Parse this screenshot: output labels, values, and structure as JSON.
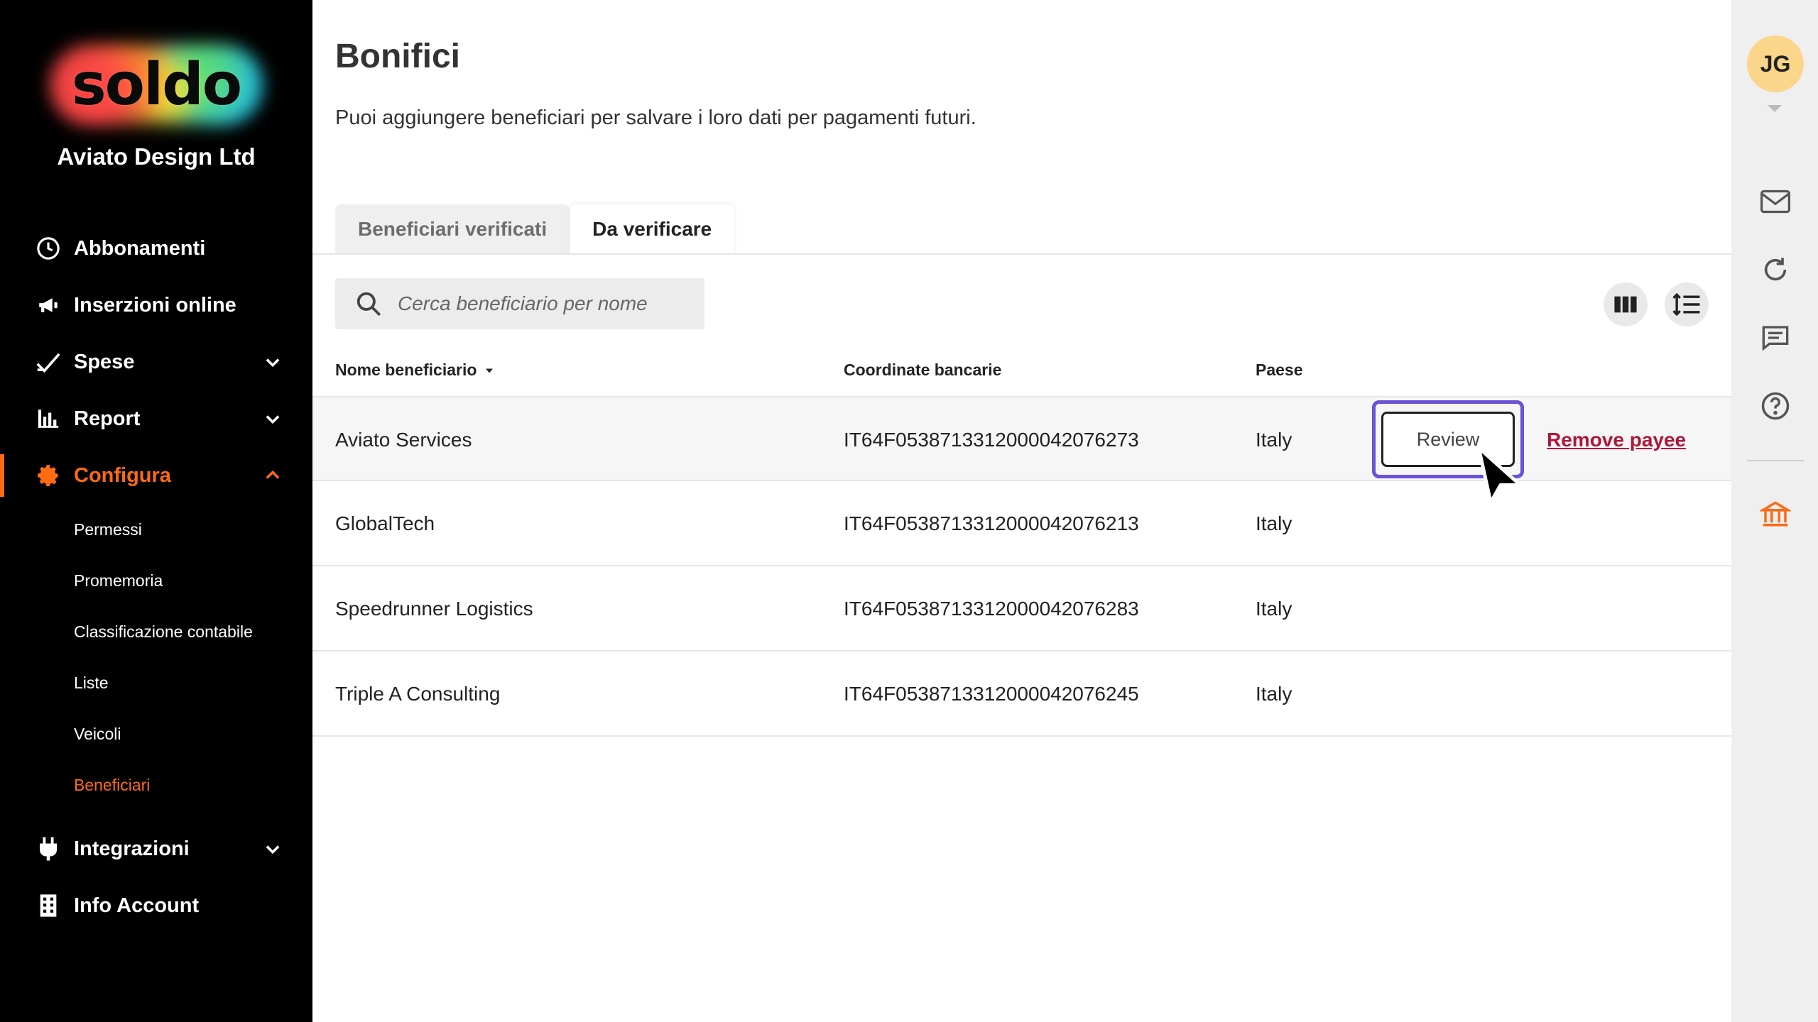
{
  "sidebar": {
    "logo_text": "soldo",
    "company": "Aviato Design Ltd",
    "items": [
      {
        "label": "Abbonamenti",
        "icon": "clock-icon"
      },
      {
        "label": "Inserzioni online",
        "icon": "megaphone-icon"
      },
      {
        "label": "Spese",
        "icon": "check-icon",
        "chevron": "down"
      },
      {
        "label": "Report",
        "icon": "bar-chart-icon",
        "chevron": "down"
      },
      {
        "label": "Configura",
        "icon": "gear-icon",
        "chevron": "up",
        "active": true
      },
      {
        "label": "Integrazioni",
        "icon": "plug-icon",
        "chevron": "down"
      },
      {
        "label": "Info Account",
        "icon": "building-icon"
      }
    ],
    "subitems": [
      "Permessi",
      "Promemoria",
      "Classificazione contabile",
      "Liste",
      "Veicoli",
      "Beneficiari"
    ],
    "active_subitem": "Beneficiari"
  },
  "header": {
    "title": "Bonifici",
    "description": "Puoi aggiungere beneficiari per salvare i loro dati per pagamenti futuri."
  },
  "tabs": [
    {
      "label": "Beneficiari verificati",
      "active": false
    },
    {
      "label": "Da verificare",
      "active": true
    }
  ],
  "search": {
    "placeholder": "Cerca beneficiario per nome"
  },
  "toolbar": {
    "columns_icon": "columns-icon",
    "density_icon": "line-spacing-icon"
  },
  "table": {
    "columns": [
      "Nome beneficiario",
      "Coordinate bancarie",
      "Paese"
    ],
    "rows": [
      {
        "name": "Aviato Services",
        "iban": "IT64F0538713312000042076273",
        "country": "Italy"
      },
      {
        "name": "GlobalTech",
        "iban": "IT64F0538713312000042076213",
        "country": "Italy"
      },
      {
        "name": "Speedrunner Logistics",
        "iban": "IT64F0538713312000042076283",
        "country": "Italy"
      },
      {
        "name": "Triple A Consulting",
        "iban": "IT64F0538713312000042076245",
        "country": "Italy"
      }
    ],
    "actions": {
      "review": "Review",
      "remove": "Remove payee"
    }
  },
  "rail": {
    "avatar_initials": "JG",
    "icons": [
      "mail-icon",
      "refresh-icon",
      "chat-icon",
      "help-icon",
      "bank-icon"
    ]
  },
  "colors": {
    "accent": "#ff6a13",
    "focus": "#6b52d6",
    "danger_link": "#b0163a"
  }
}
